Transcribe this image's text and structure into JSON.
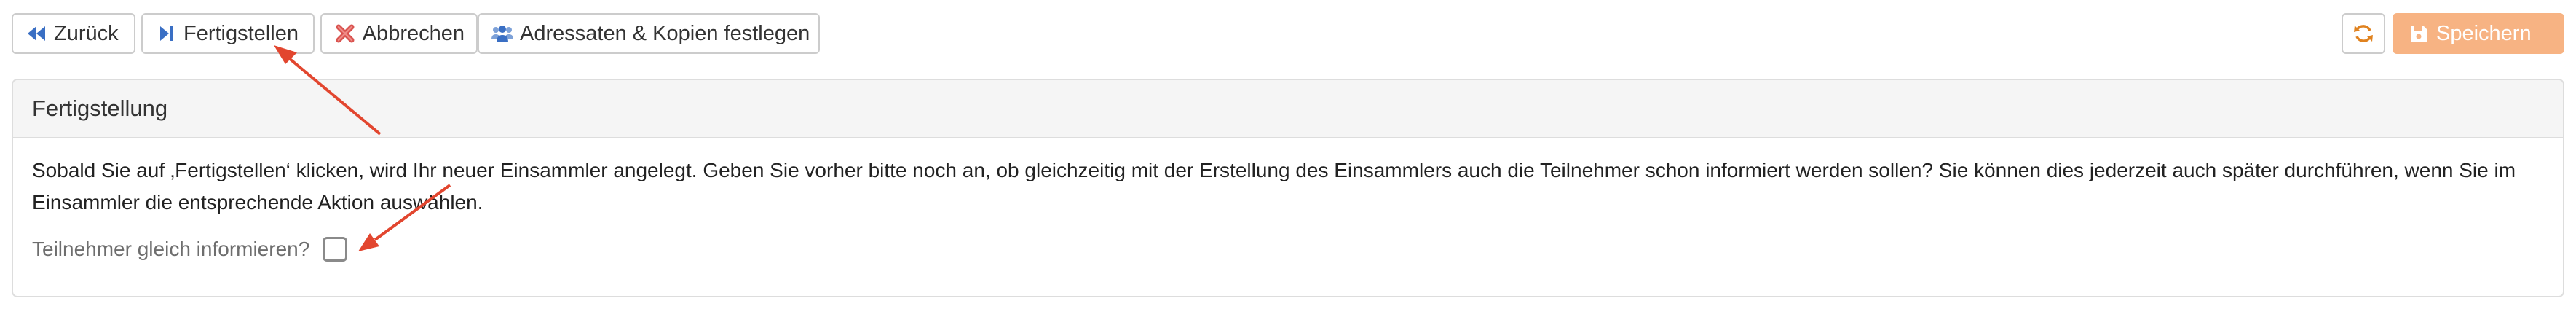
{
  "toolbar": {
    "back_label": "Zurück",
    "finish_label": "Fertigstellen",
    "cancel_label": "Abbrechen",
    "recipients_label": "Adressaten & Kopien festlegen",
    "save_label": "Speichern"
  },
  "panel": {
    "title": "Fertigstellung",
    "description": "Sobald Sie auf ‚Fertigstellen‘ klicken, wird Ihr neuer Einsammler angelegt. Geben Sie vorher bitte noch an, ob gleichzeitig mit der Erstellung des Einsammlers auch die Teilnehmer schon informiert werden sollen? Sie können dies jederzeit auch später durchführen, wenn Sie im Einsammler die entsprechende Aktion auswählen.",
    "notify_label": "Teilnehmer gleich informieren?",
    "notify_checked": false
  },
  "icons": {
    "back": "backward-step-icon",
    "finish": "play-step-icon",
    "cancel": "red-x-icon",
    "recipients": "users-group-icon",
    "refresh": "refresh-icon",
    "save": "floppy-disk-icon"
  },
  "colors": {
    "primary_blue": "#3a6fc4",
    "cancel_red": "#d9534f",
    "refresh_orange": "#e0821f",
    "save_bg": "#f7b383",
    "annotation_arrow": "#e2462f"
  }
}
